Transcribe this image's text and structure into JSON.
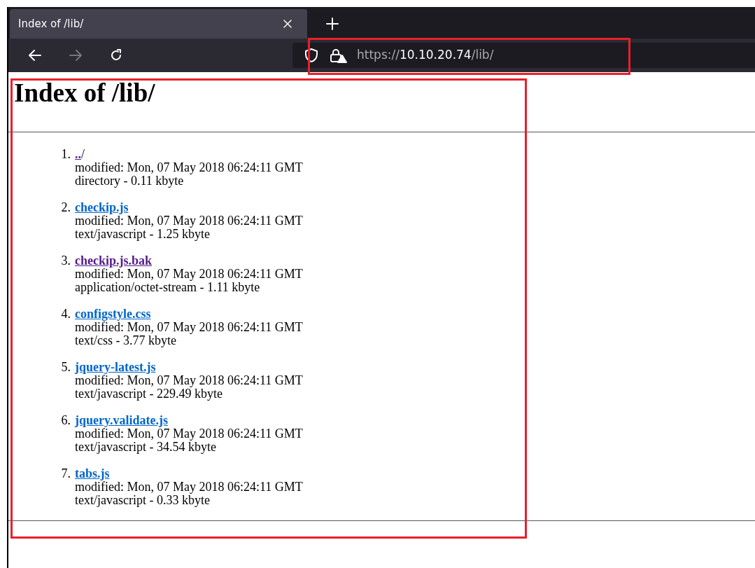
{
  "browser": {
    "tab": {
      "title": "Index of /lib/",
      "selected": true
    },
    "address": {
      "scheme": "https://",
      "host": "10.10.20.74",
      "path": "/lib/"
    }
  },
  "page": {
    "heading": "Index of /lib/",
    "entries": [
      {
        "number": "1.",
        "link": "..",
        "suffix": "/",
        "visited": true,
        "modified": "modified: Mon, 07 May 2018 06:24:11 GMT",
        "info": "directory - 0.11 kbyte"
      },
      {
        "number": "2.",
        "link": "checkip.js",
        "visited": false,
        "modified": "modified: Mon, 07 May 2018 06:24:11 GMT",
        "info": "text/javascript - 1.25 kbyte"
      },
      {
        "number": "3.",
        "link": "checkip.js.bak",
        "visited": true,
        "modified": "modified: Mon, 07 May 2018 06:24:11 GMT",
        "info": "application/octet-stream - 1.11 kbyte"
      },
      {
        "number": "4.",
        "link": "configstyle.css",
        "visited": false,
        "modified": "modified: Mon, 07 May 2018 06:24:11 GMT",
        "info": "text/css - 3.77 kbyte"
      },
      {
        "number": "5.",
        "link": "jquery-latest.js",
        "visited": false,
        "modified": "modified: Mon, 07 May 2018 06:24:11 GMT",
        "info": "text/javascript - 229.49 kbyte"
      },
      {
        "number": "6.",
        "link": "jquery.validate.js",
        "visited": false,
        "modified": "modified: Mon, 07 May 2018 06:24:11 GMT",
        "info": "text/javascript - 34.54 kbyte"
      },
      {
        "number": "7.",
        "link": "tabs.js",
        "visited": false,
        "modified": "modified: Mon, 07 May 2018 06:24:11 GMT",
        "info": "text/javascript - 0.33 kbyte"
      }
    ]
  }
}
